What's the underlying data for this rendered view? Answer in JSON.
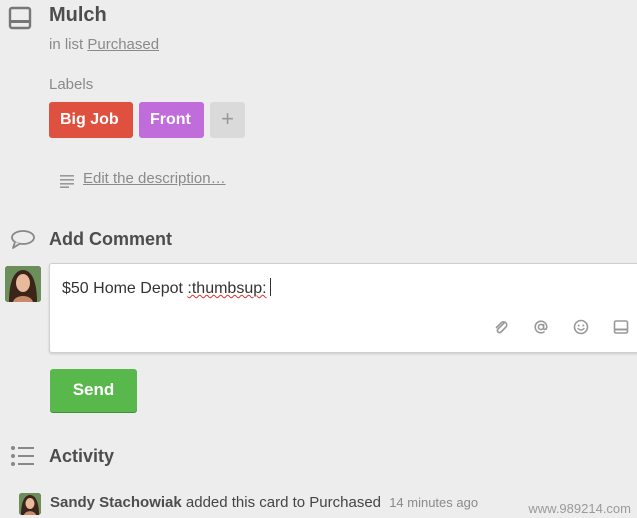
{
  "card": {
    "title": "Mulch",
    "list_prefix": "in list",
    "list_name": "Purchased"
  },
  "labels": {
    "heading": "Labels",
    "items": [
      {
        "text": "Big Job",
        "color": "#e0503f"
      },
      {
        "text": "Front",
        "color": "#c06ddb"
      }
    ],
    "add_symbol": "+"
  },
  "description": {
    "link_text": "Edit the description…"
  },
  "comment": {
    "heading": "Add Comment",
    "text_prefix": "$50 Home Depot ",
    "text_flagged": ":thumbsup:",
    "send_label": "Send",
    "tools": [
      "attachment-icon",
      "mention-icon",
      "emoji-icon",
      "card-icon"
    ]
  },
  "activity": {
    "heading": "Activity",
    "entries": [
      {
        "user": "Sandy Stachowiak",
        "action": "added this card to Purchased",
        "time": "14 minutes ago"
      }
    ]
  },
  "watermark": "www.989214.com",
  "colors": {
    "send_green": "#58b84b",
    "label_red": "#e0503f",
    "label_purple": "#c06ddb",
    "background": "#ededed"
  }
}
